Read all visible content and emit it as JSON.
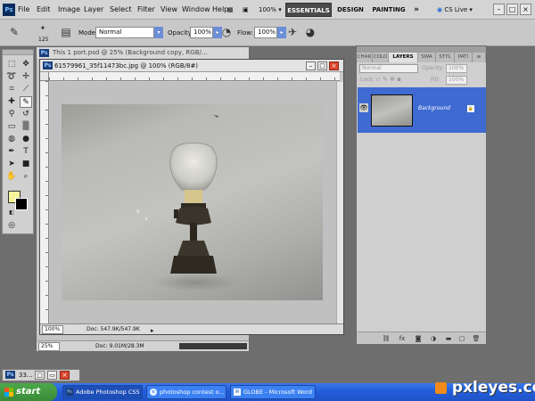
{
  "app": {
    "logo_text": "Ps",
    "menu": [
      "File",
      "Edit",
      "Image",
      "Layer",
      "Select",
      "Filter",
      "View",
      "Window",
      "Help"
    ],
    "zoom": "100%",
    "workspaces": [
      "ESSENTIALS",
      "DESIGN",
      "PAINTING"
    ],
    "more": "»",
    "cs_live": "CS Live",
    "window_controls": [
      "–",
      "□",
      "×"
    ]
  },
  "options_bar": {
    "brush_size": "125",
    "mode_label": "Mode:",
    "mode_value": "Normal",
    "opacity_label": "Opacity:",
    "opacity_value": "100%",
    "flow_label": "Flow:",
    "flow_value": "100%"
  },
  "tools": {
    "foreground_color": "#f7f39a",
    "background_color": "#000000"
  },
  "doc_back": {
    "badge": "Ps",
    "title": "This 1 port.psd @ 25% (Background copy, RGB/...",
    "zoom": "25%",
    "status": "Doc: 9.01M/28.3M"
  },
  "doc_front": {
    "badge": "Ps",
    "title": "61579961_35f11473bc.jpg @ 100% (RGB/8#)",
    "zoom": "100%",
    "status": "Doc: 547.9K/547.9K",
    "buttons": [
      "–",
      "□",
      "×"
    ]
  },
  "layers_panel": {
    "tabs": [
      "CHAR",
      "COLO",
      "LAYERS",
      "SWA",
      "STYL",
      "PATI"
    ],
    "active_tab": "LAYERS",
    "blend_mode": "Normal",
    "opacity_label": "Opacity:",
    "opacity_value": "100%",
    "lock_label": "Lock:",
    "fill_label": "Fill:",
    "fill_value": "100%",
    "layer_name": "Background",
    "footer_icons": [
      "link-icon",
      "fx-icon",
      "mask-icon",
      "adjustment-icon",
      "folder-icon",
      "new-layer-icon",
      "trash-icon"
    ]
  },
  "minimized": {
    "title": "33..."
  },
  "taskbar": {
    "start_label": "start",
    "tasks": [
      "Adobe Photoshop CS5",
      "photoshop contest o...",
      "GLOBE - Microsoft Word"
    ],
    "watermark": "pxleyes.com"
  }
}
